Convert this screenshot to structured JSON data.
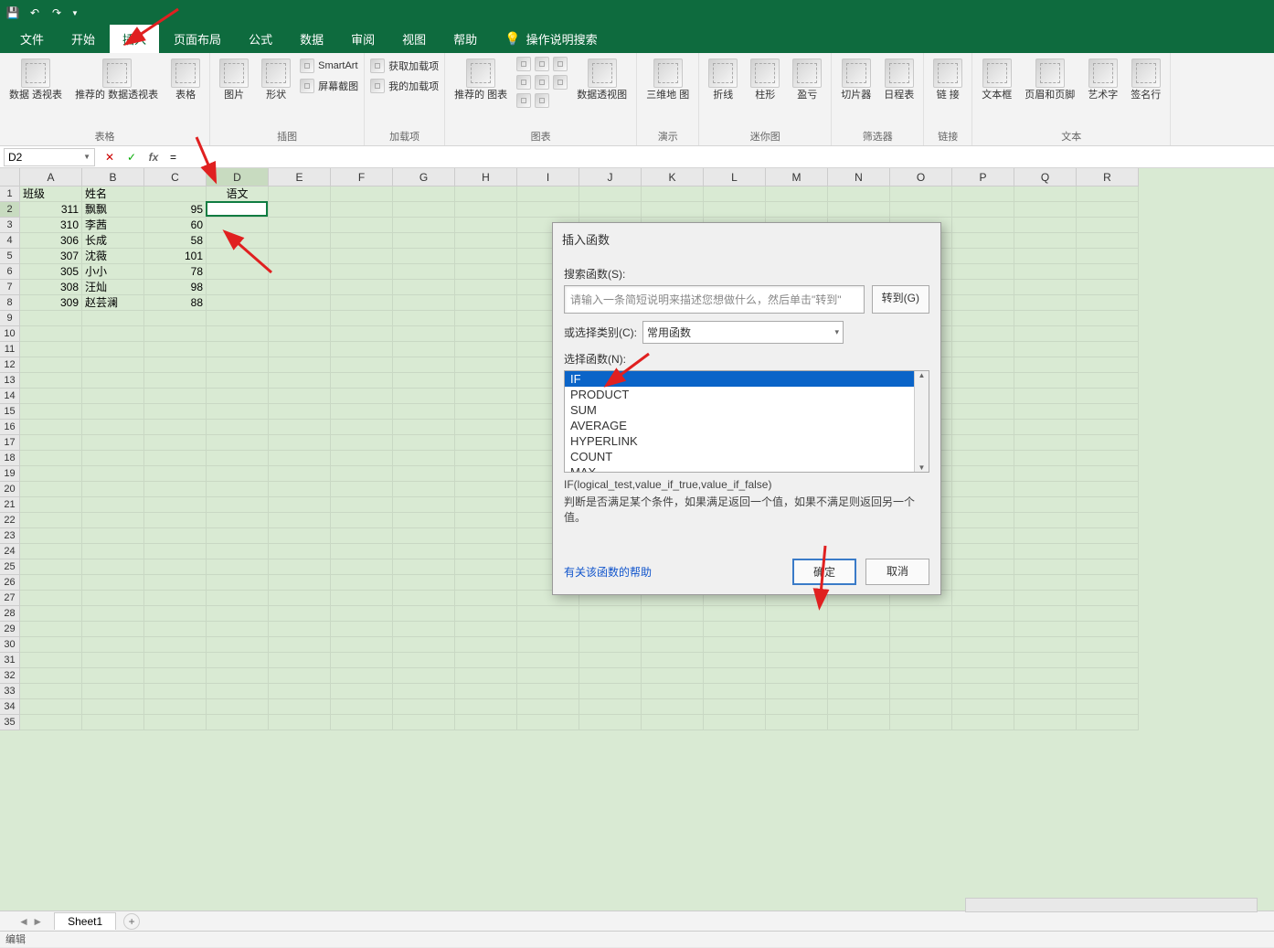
{
  "qat": {
    "save": "💾",
    "undo": "↶",
    "redo": "↷"
  },
  "tabs": {
    "file": "文件",
    "home": "开始",
    "insert": "插入",
    "layout": "页面布局",
    "formulas": "公式",
    "data": "数据",
    "review": "审阅",
    "view": "视图",
    "help": "帮助",
    "tell": "操作说明搜索"
  },
  "ribbon": {
    "tables": {
      "pivot": "数据\n透视表",
      "recommended": "推荐的\n数据透视表",
      "table": "表格",
      "group": "表格"
    },
    "illus": {
      "pictures": "图片",
      "shapes": "形状",
      "smartart": "SmartArt",
      "screenshot": "屏幕截图",
      "group": "插图"
    },
    "addins": {
      "get": "获取加载项",
      "my": "我的加载项",
      "group": "加载项"
    },
    "charts": {
      "recommended": "推荐的\n图表",
      "pivot_chart": "数据透视图",
      "map3d": "三维地\n图",
      "group": "图表",
      "tours": "演示"
    },
    "spark": {
      "line": "折线",
      "col": "柱形",
      "winloss": "盈亏",
      "group": "迷你图"
    },
    "filter": {
      "slicer": "切片器",
      "timeline": "日程表",
      "group": "筛选器"
    },
    "links": {
      "link": "链\n接",
      "group": "链接"
    },
    "text": {
      "textbox": "文本框",
      "header_footer": "页眉和页脚",
      "wordart": "艺术字",
      "sigline": "签名行",
      "group": "文本"
    }
  },
  "formula_bar": {
    "name_box": "D2",
    "formula": "="
  },
  "columns": [
    "A",
    "B",
    "C",
    "D",
    "E",
    "F",
    "G",
    "H",
    "I",
    "J",
    "K",
    "L",
    "M",
    "N",
    "O",
    "P",
    "Q",
    "R"
  ],
  "sheet": {
    "header_row": [
      "班级",
      "姓名",
      "",
      "语文"
    ],
    "rows": [
      {
        "class": "311",
        "name": "飘飘",
        "score": "95",
        "d": "="
      },
      {
        "class": "310",
        "name": "李茜",
        "score": "60",
        "d": ""
      },
      {
        "class": "306",
        "name": "长成",
        "score": "58",
        "d": ""
      },
      {
        "class": "307",
        "name": "沈薇",
        "score": "101",
        "d": ""
      },
      {
        "class": "305",
        "name": "小小",
        "score": "78",
        "d": ""
      },
      {
        "class": "308",
        "name": "汪灿",
        "score": "98",
        "d": ""
      },
      {
        "class": "309",
        "name": "赵芸澜",
        "score": "88",
        "d": ""
      }
    ],
    "total_rows": 35,
    "active": {
      "col": 3,
      "row": 1
    }
  },
  "sheet_tabs": {
    "sheet1": "Sheet1"
  },
  "status": "编辑",
  "dialog": {
    "title": "插入函数",
    "search_label": "搜索函数(S):",
    "search_placeholder": "请输入一条简短说明来描述您想做什么，然后单击\"转到\"",
    "go": "转到(G)",
    "category_label": "或选择类别(C):",
    "category_value": "常用函数",
    "select_label": "选择函数(N):",
    "functions": [
      "IF",
      "PRODUCT",
      "SUM",
      "AVERAGE",
      "HYPERLINK",
      "COUNT",
      "MAX"
    ],
    "signature": "IF(logical_test,value_if_true,value_if_false)",
    "description": "判断是否满足某个条件，如果满足返回一个值，如果不满足则返回另一个值。",
    "help": "有关该函数的帮助",
    "ok": "确定",
    "cancel": "取消"
  }
}
